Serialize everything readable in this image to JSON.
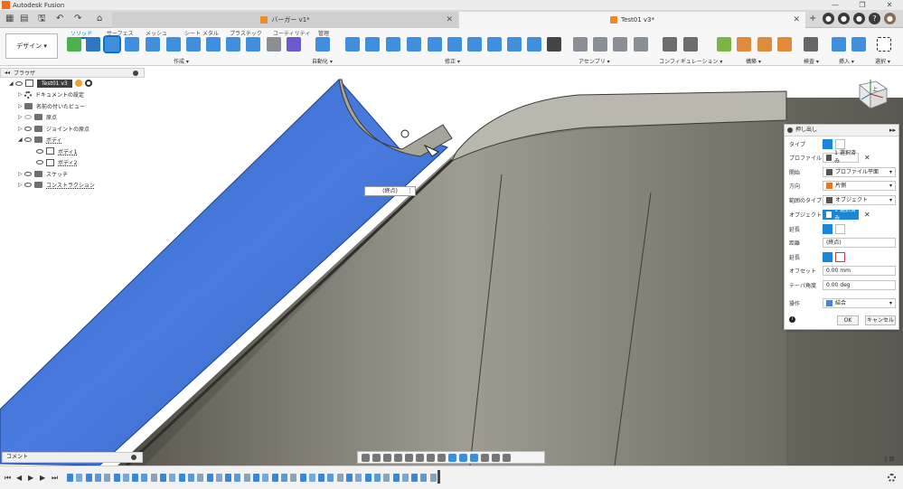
{
  "window": {
    "title": "Autodesk Fusion",
    "min": "—",
    "max": "❐",
    "close": "✕"
  },
  "quick_access": {
    "grid": "▦",
    "file": "▤",
    "save": "🖫",
    "undo": "↶",
    "redo": "↷",
    "home": "⌂"
  },
  "tabs": [
    {
      "label": "バーガー v1*"
    },
    {
      "label": "Test01 v3*"
    }
  ],
  "tab_close": "✕",
  "tab_add": "+",
  "ribbon": {
    "design_label": "デザイン ▾",
    "tabs": [
      "ソリッド",
      "サーフェス",
      "メッシュ",
      "シート メタル",
      "プラスチック",
      "ユーティリティ",
      "管理"
    ],
    "groups": [
      "作成 ▾",
      "自動化 ▾",
      "修正 ▾",
      "アセンブリ ▾",
      "コンフィギュレーション ▾",
      "構築 ▾",
      "検査 ▾",
      "挿入 ▾",
      "選択 ▾"
    ]
  },
  "browser": {
    "title": "ブラウザ",
    "items": [
      {
        "label": "Test01 v3",
        "type": "component"
      },
      {
        "label": "ドキュメントの設定",
        "type": "settings"
      },
      {
        "label": "名前の付いたビュー",
        "type": "folder"
      },
      {
        "label": "原点",
        "type": "folder"
      },
      {
        "label": "ジョイントの原点",
        "type": "folder"
      },
      {
        "label": "ボディ",
        "type": "folder"
      },
      {
        "label": "ボディ1",
        "type": "body"
      },
      {
        "label": "ボディ2",
        "type": "body"
      },
      {
        "label": "スケッチ",
        "type": "folder"
      },
      {
        "label": "コンストラクション",
        "type": "folder"
      }
    ]
  },
  "comment": {
    "label": "コメント"
  },
  "canvas": {
    "distance_value": "(終点)"
  },
  "view_cube": {
    "face_label": "上"
  },
  "dialog": {
    "title": "押し出し",
    "rows": {
      "type": "タイプ",
      "profile": "プロファイル",
      "profile_value": "1 選択済み",
      "start": "開始",
      "start_value": "プロファイル平面",
      "direction": "方向",
      "direction_value": "片側",
      "extent_type": "範囲のタイプ",
      "extent_value": "オブジェクト",
      "object": "オブジェクト",
      "object_value": "1 選択済み",
      "extend1": "延長",
      "distance": "距離",
      "distance_value": "(終点)",
      "extend2": "延長",
      "offset": "オフセット",
      "offset_value": "0.00 mm",
      "taper": "テーパ角度",
      "taper_value": "0.00 deg",
      "operation": "操作",
      "operation_value": "結合"
    },
    "ok": "OK",
    "cancel": "キャンセル",
    "info": "i",
    "clear": "✕"
  },
  "timeline": {
    "first": "⏮",
    "prev": "◀",
    "play": "▶",
    "next": "▶",
    "last": "⏭"
  },
  "status": {
    "count": "2 面"
  }
}
